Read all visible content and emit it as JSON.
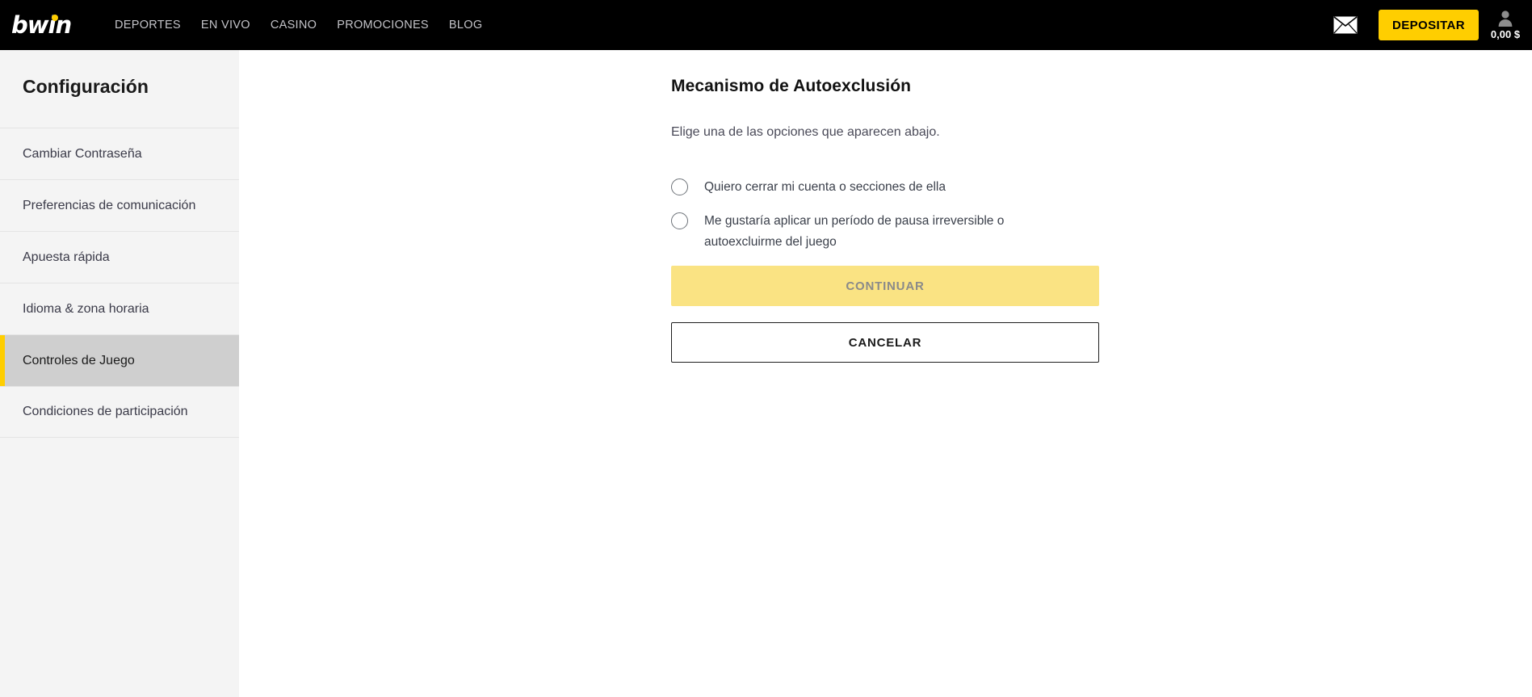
{
  "header": {
    "logo_text": "bwin",
    "logo_icon": "bwin-logo",
    "nav": [
      {
        "label": "DEPORTES"
      },
      {
        "label": "EN VIVO"
      },
      {
        "label": "CASINO"
      },
      {
        "label": "PROMOCIONES"
      },
      {
        "label": "BLOG"
      }
    ],
    "mail_icon": "envelope-icon",
    "deposit_label": "DEPOSITAR",
    "account_icon": "person-icon",
    "balance": "0,00 $",
    "background_color": "#000000",
    "accent_color": "#ffce00"
  },
  "sidebar": {
    "title": "Configuración",
    "items": [
      {
        "label": "Cambiar Contraseña",
        "active": false
      },
      {
        "label": "Preferencias de comunicación",
        "active": false
      },
      {
        "label": "Apuesta rápida",
        "active": false
      },
      {
        "label": "Idioma & zona horaria",
        "active": false
      },
      {
        "label": "Controles de Juego",
        "active": true
      },
      {
        "label": "Condiciones de participación",
        "active": false
      }
    ],
    "background_color": "#f4f4f4",
    "active_background_color": "#cfcfcf",
    "active_marker_color": "#ffce00"
  },
  "main": {
    "title": "Mecanismo de Autoexclusión",
    "subtitle": "Elige una de las opciones que aparecen abajo.",
    "options": [
      {
        "label": "Quiero cerrar mi cuenta o secciones de ella",
        "selected": false
      },
      {
        "label": "Me gustaría aplicar un período de pausa irreversible o autoexcluirme del juego",
        "selected": false
      }
    ],
    "continue_label": "CONTINUAR",
    "cancel_label": "CANCELAR",
    "continue_color": "#fae383",
    "continue_text_color": "#8a8a8a"
  }
}
